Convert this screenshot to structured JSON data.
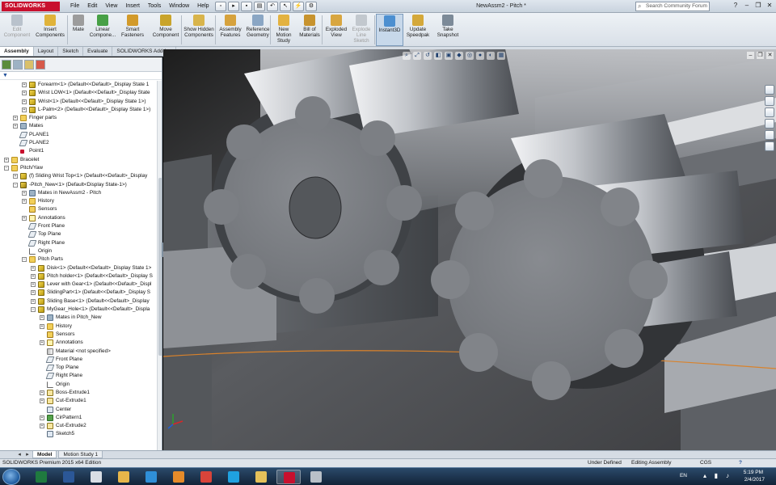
{
  "app": {
    "logo_text": "SOLIDWORKS",
    "document_title": "NewAssm2 - Pitch *",
    "menu": [
      "File",
      "Edit",
      "View",
      "Insert",
      "Tools",
      "Window",
      "Help"
    ],
    "search_placeholder": "Search Community Forum"
  },
  "ribbon": [
    {
      "label": "Edit Component",
      "disabled": true,
      "icon": "edit-component-icon",
      "color": "#b9c2cc"
    },
    {
      "label": "Insert Components",
      "icon": "insert-components-icon",
      "color": "#e0b33a"
    },
    {
      "label": "Mate",
      "icon": "mate-icon",
      "color": "#9c9c9c"
    },
    {
      "label": "Linear Compone...",
      "icon": "linear-pattern-icon",
      "color": "#47a046"
    },
    {
      "label": "Smart Fasteners",
      "icon": "smart-fasteners-icon",
      "color": "#d29a2a"
    },
    {
      "label": "Move Component",
      "icon": "move-component-icon",
      "color": "#c9a42b"
    },
    {
      "label": "Show Hidden Components",
      "icon": "show-hidden-icon",
      "color": "#d8b44b"
    },
    {
      "label": "Assembly Features",
      "icon": "assembly-features-icon",
      "color": "#d6a23d"
    },
    {
      "label": "Reference Geometry",
      "icon": "reference-geometry-icon",
      "color": "#8aa6c4"
    },
    {
      "label": "New Motion Study",
      "icon": "motion-study-icon",
      "color": "#e3b240"
    },
    {
      "label": "Bill of Materials",
      "icon": "bom-icon",
      "color": "#c7932e"
    },
    {
      "label": "Exploded View",
      "icon": "exploded-view-icon",
      "color": "#d8a640"
    },
    {
      "label": "Explode Line Sketch",
      "disabled": true,
      "icon": "explode-line-icon",
      "color": "#c2c8ce"
    },
    {
      "label": "Instant3D",
      "active": true,
      "icon": "instant3d-icon",
      "color": "#4c8fd0"
    },
    {
      "label": "Update Speedpak",
      "icon": "speedpak-icon",
      "color": "#d4a83a"
    },
    {
      "label": "Take Snapshot",
      "icon": "snapshot-icon",
      "color": "#7c8a98"
    }
  ],
  "tabs": [
    "Assembly",
    "Layout",
    "Sketch",
    "Evaluate",
    "SOLIDWORKS Add-Ins"
  ],
  "tree_filter": "▼",
  "tree": [
    {
      "label": "Forearm<1> (Default<<Default>_Display State 1",
      "level": 2,
      "icon": "part",
      "exp": "+"
    },
    {
      "label": "Wrist LOW<1> (Default<<Default>_Display State",
      "level": 2,
      "icon": "part",
      "exp": "+"
    },
    {
      "label": "Wrist<1> (Default<<Default>_Display State 1>)",
      "level": 2,
      "icon": "part",
      "exp": "+"
    },
    {
      "label": "L-Palm<2> (Default<<Default>_Display State 1>)",
      "level": 2,
      "icon": "part",
      "exp": "+"
    },
    {
      "label": "Finger parts",
      "level": 1,
      "icon": "folder",
      "exp": "+"
    },
    {
      "label": "Mates",
      "level": 1,
      "icon": "mate",
      "exp": "+"
    },
    {
      "label": "PLANE1",
      "level": 1,
      "icon": "plane"
    },
    {
      "label": "PLANE2",
      "level": 1,
      "icon": "plane"
    },
    {
      "label": "Point1",
      "level": 1,
      "icon": "point"
    },
    {
      "label": "Bracelet",
      "level": 0,
      "icon": "folder",
      "exp": "+"
    },
    {
      "label": "Pitch/Yaw",
      "level": 0,
      "icon": "folder",
      "exp": "−"
    },
    {
      "label": "(f) Sliding Wrist Top<1> (Default<<Default>_Display",
      "level": 1,
      "icon": "part",
      "exp": "+"
    },
    {
      "label": "-Pitch_New<1> (Default<Display State-1>)",
      "level": 1,
      "icon": "asm",
      "exp": "−"
    },
    {
      "label": "Mates in NewAssm2 - Pitch",
      "level": 2,
      "icon": "mate",
      "exp": "+"
    },
    {
      "label": "History",
      "level": 2,
      "icon": "folder",
      "exp": "+"
    },
    {
      "label": "Sensors",
      "level": 2,
      "icon": "sensor"
    },
    {
      "label": "Annotations",
      "level": 2,
      "icon": "annot",
      "exp": "+"
    },
    {
      "label": "Front Plane",
      "level": 2,
      "icon": "plane"
    },
    {
      "label": "Top Plane",
      "level": 2,
      "icon": "plane"
    },
    {
      "label": "Right Plane",
      "level": 2,
      "icon": "plane"
    },
    {
      "label": "Origin",
      "level": 2,
      "icon": "origin"
    },
    {
      "label": "Pitch Parts",
      "level": 2,
      "icon": "folder",
      "exp": "−"
    },
    {
      "label": "Disk<1> (Default<<Default>_Display State 1>",
      "level": 3,
      "icon": "part",
      "exp": "+"
    },
    {
      "label": "Pitch holder<1> (Default<<Default>_Display S",
      "level": 3,
      "icon": "part",
      "exp": "+"
    },
    {
      "label": "Lever with Gear<1> (Default<<Default>_Displ",
      "level": 3,
      "icon": "part",
      "exp": "+"
    },
    {
      "label": "SlidingPart<1> (Default<<Default>_Display S",
      "level": 3,
      "icon": "part",
      "exp": "+"
    },
    {
      "label": "Sliding Base<1> (Default<<Default>_Display",
      "level": 3,
      "icon": "part",
      "exp": "+"
    },
    {
      "label": "MyGear_Hole<1> (Default<<Default>_Displa",
      "level": 3,
      "icon": "part",
      "exp": "−"
    },
    {
      "label": "Mates in Pitch_New",
      "level": 4,
      "icon": "mate",
      "exp": "+"
    },
    {
      "label": "History",
      "level": 4,
      "icon": "folder",
      "exp": "+"
    },
    {
      "label": "Sensors",
      "level": 4,
      "icon": "sensor"
    },
    {
      "label": "Annotations",
      "level": 4,
      "icon": "annot",
      "exp": "+"
    },
    {
      "label": "Material <not specified>",
      "level": 4,
      "icon": "mat"
    },
    {
      "label": "Front Plane",
      "level": 4,
      "icon": "plane"
    },
    {
      "label": "Top Plane",
      "level": 4,
      "icon": "plane"
    },
    {
      "label": "Right Plane",
      "level": 4,
      "icon": "plane"
    },
    {
      "label": "Origin",
      "level": 4,
      "icon": "origin"
    },
    {
      "label": "Boss-Extrude1",
      "level": 4,
      "icon": "feat",
      "exp": "+"
    },
    {
      "label": "Cut-Extrude1",
      "level": 4,
      "icon": "feat",
      "exp": "+"
    },
    {
      "label": "Center",
      "level": 4,
      "icon": "sketch"
    },
    {
      "label": "CirPattern1",
      "level": 4,
      "icon": "pattern",
      "exp": "+"
    },
    {
      "label": "Cut-Extrude2",
      "level": 4,
      "icon": "feat",
      "exp": "+"
    },
    {
      "label": "Sketch5",
      "level": 4,
      "icon": "sketch"
    }
  ],
  "bottom_tabs": [
    "Model",
    "Motion Study 1"
  ],
  "status": {
    "edition": "SOLIDWORKS Premium 2015 x64 Edition",
    "definition": "Under Defined",
    "mode": "Editing Assembly",
    "units": "CGS",
    "help": "?"
  },
  "taskbar": {
    "apps": [
      {
        "name": "excel-icon",
        "color": "#1f7a3f"
      },
      {
        "name": "word-icon",
        "color": "#2b5797"
      },
      {
        "name": "document-icon",
        "color": "#d9dee5"
      },
      {
        "name": "paint-icon",
        "color": "#e7b64a"
      },
      {
        "name": "internet-explorer-icon",
        "color": "#2f8fd8"
      },
      {
        "name": "media-player-icon",
        "color": "#e58b2a"
      },
      {
        "name": "chrome-icon",
        "color": "#d8443a"
      },
      {
        "name": "skype-icon",
        "color": "#1fa1e0"
      },
      {
        "name": "file-explorer-icon",
        "color": "#e5c15a"
      },
      {
        "name": "solidworks-icon",
        "color": "#c8102e"
      },
      {
        "name": "tools-icon",
        "color": "#b9c0c8"
      }
    ],
    "language": "EN",
    "time": "5:19 PM",
    "date": "2/4/2017"
  }
}
